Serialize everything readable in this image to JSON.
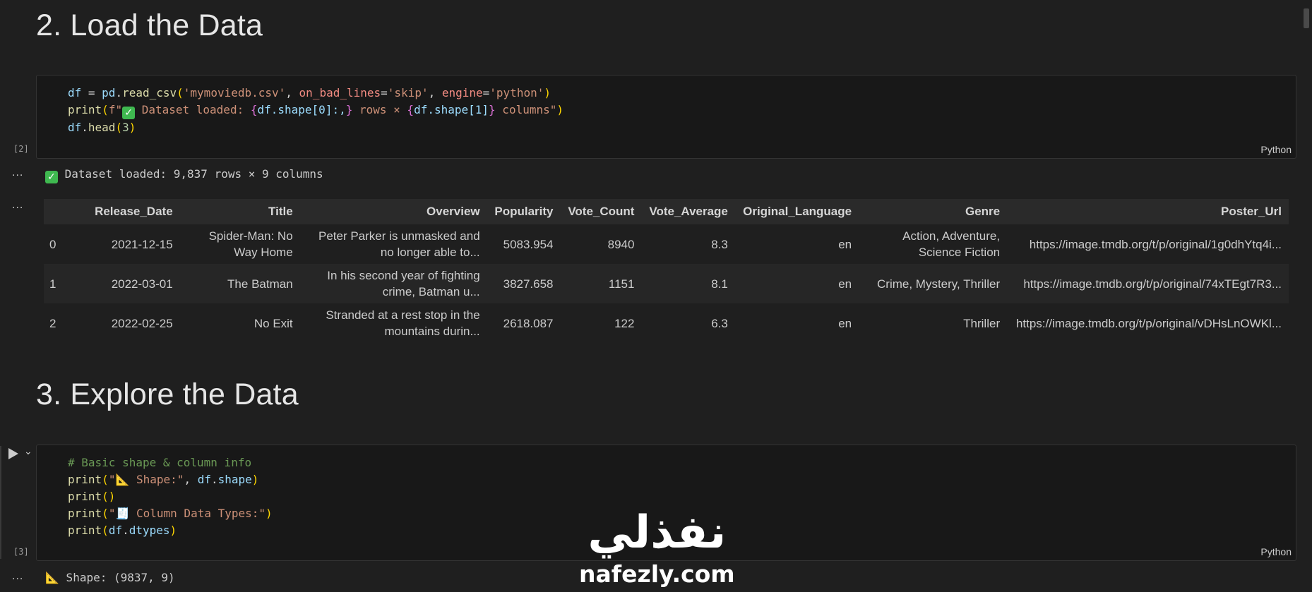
{
  "section_load": {
    "heading": "2. Load the Data"
  },
  "cell_load": {
    "exec_count": "[2]",
    "language": "Python",
    "line1": {
      "var": "df",
      "eq": " = ",
      "mod": "pd",
      "dot": ".",
      "fn": "read_csv",
      "lp": "(",
      "arg1": "'mymoviedb.csv'",
      "comma1": ", ",
      "kw1": "on_bad_lines",
      "eq1": "=",
      "arg2": "'skip'",
      "comma2": ", ",
      "kw2": "engine",
      "eq2": "=",
      "arg3": "'python'",
      "rp": ")"
    },
    "line2": {
      "fn": "print",
      "lp": "(",
      "pre": "f\"",
      "emoji": "✓",
      "text": " Dataset loaded: ",
      "b1": "{",
      "e1": "df.shape[0]:,",
      "b1c": "}",
      "mid": " rows × ",
      "b2": "{",
      "e2": "df.shape[1]",
      "b2c": "}",
      "end": " columns\"",
      "rp": ")"
    },
    "line3": {
      "var": "df",
      "dot": ".",
      "fn": "head",
      "lp": "(",
      "num": "3",
      "rp": ")"
    }
  },
  "output_load": {
    "dots": "...",
    "message": "Dataset loaded: 9,837 rows × 9 columns",
    "check_icon": "✓"
  },
  "dataframe": {
    "dots": "...",
    "columns": [
      "",
      "Release_Date",
      "Title",
      "Overview",
      "Popularity",
      "Vote_Count",
      "Vote_Average",
      "Original_Language",
      "Genre",
      "Poster_Url"
    ],
    "rows": [
      [
        "0",
        "2021-12-15",
        "Spider-Man: No Way Home",
        "Peter Parker is unmasked and no longer able to...",
        "5083.954",
        "8940",
        "8.3",
        "en",
        "Action, Adventure, Science Fiction",
        "https://image.tmdb.org/t/p/original/1g0dhYtq4i..."
      ],
      [
        "1",
        "2022-03-01",
        "The Batman",
        "In his second year of fighting crime, Batman u...",
        "3827.658",
        "1151",
        "8.1",
        "en",
        "Crime, Mystery, Thriller",
        "https://image.tmdb.org/t/p/original/74xTEgt7R3..."
      ],
      [
        "2",
        "2022-02-25",
        "No Exit",
        "Stranded at a rest stop in the mountains durin...",
        "2618.087",
        "122",
        "6.3",
        "en",
        "Thriller",
        "https://image.tmdb.org/t/p/original/vDHsLnOWKl..."
      ]
    ]
  },
  "section_explore": {
    "heading": "3. Explore the Data"
  },
  "cell_explore": {
    "exec_count": "[3]",
    "language": "Python",
    "comment": "# Basic shape & column info",
    "line2": {
      "fn": "print",
      "lp": "(",
      "str": "\"📐 Shape:\"",
      "comma": ", ",
      "var": "df",
      "dot": ".",
      "attr": "shape",
      "rp": ")"
    },
    "line3": {
      "fn": "print",
      "parens": "()"
    },
    "line4": {
      "fn": "print",
      "lp": "(",
      "str": "\"🧾 Column Data Types:\"",
      "rp": ")"
    },
    "line5": {
      "fn": "print",
      "lp": "(",
      "var": "df",
      "dot": ".",
      "attr": "dtypes",
      "rp": ")"
    }
  },
  "output_explore": {
    "dots": "...",
    "message": "📐 Shape: (9837, 9)"
  },
  "watermark": {
    "arabic": "نفذلي",
    "latin": "nafezly.com"
  },
  "colors": {
    "background": "#1f1f1f",
    "cell_bg": "#181818",
    "check": "#3fb950"
  }
}
